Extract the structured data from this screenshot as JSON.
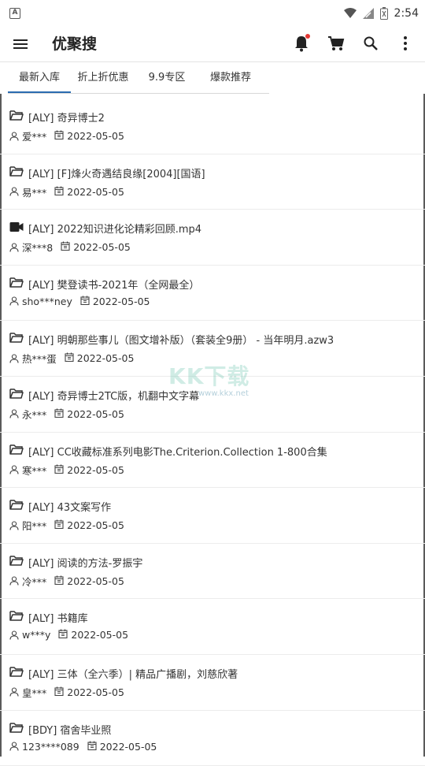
{
  "status_bar": {
    "time": "2:54",
    "left_icon_label": "A"
  },
  "app_bar": {
    "title": "优聚搜"
  },
  "tabs": [
    {
      "label": "最新入库"
    },
    {
      "label": "折上折优惠"
    },
    {
      "label": "9.9专区"
    },
    {
      "label": "爆款推荐"
    }
  ],
  "items": [
    {
      "icon": "folder-icon",
      "name": "[ALY] 奇异博士2",
      "user": "爱***",
      "date": "2022-05-05"
    },
    {
      "icon": "folder-icon",
      "name": "[ALY] [F]烽火奇遇结良缘[2004][国语]",
      "user": "易***",
      "date": "2022-05-05"
    },
    {
      "icon": "video-icon",
      "name": "[ALY] 2022知识进化论精彩回顾.mp4",
      "user": "深***8",
      "date": "2022-05-05"
    },
    {
      "icon": "folder-icon",
      "name": "[ALY] 樊登读书-2021年（全网最全）",
      "user": "sho***ney",
      "date": "2022-05-05"
    },
    {
      "icon": "folder-icon",
      "name": "[ALY] 明朝那些事儿（图文增补版）（套装全9册） - 当年明月.azw3",
      "user": "热***蛋",
      "date": "2022-05-05"
    },
    {
      "icon": "folder-icon",
      "name": "[ALY] 奇异博士2TC版，机翻中文字幕",
      "user": "永***",
      "date": "2022-05-05"
    },
    {
      "icon": "folder-icon",
      "name": "[ALY] CC收藏标准系列电影The.Criterion.Collection 1-800合集",
      "user": "寒***",
      "date": "2022-05-05"
    },
    {
      "icon": "folder-icon",
      "name": "[ALY] 43文案写作",
      "user": "阳***",
      "date": "2022-05-05"
    },
    {
      "icon": "folder-icon",
      "name": "[ALY] 阅读的方法-罗振宇",
      "user": "冷***",
      "date": "2022-05-05"
    },
    {
      "icon": "folder-icon",
      "name": "[ALY] 书籍库",
      "user": "w***y",
      "date": "2022-05-05"
    },
    {
      "icon": "folder-icon",
      "name": "[ALY] 三体（全六季）| 精品广播剧，刘慈欣著",
      "user": "皇***",
      "date": "2022-05-05"
    },
    {
      "icon": "folder-icon",
      "name": "[BDY] 宿舍毕业照",
      "user": "123****089",
      "date": "2022-05-05"
    }
  ],
  "watermark": {
    "text": "KK下载",
    "sub": "www.kkx.net"
  },
  "colors": {
    "accent": "#2b6cb0",
    "badge": "#e53935",
    "text": "#333333"
  }
}
